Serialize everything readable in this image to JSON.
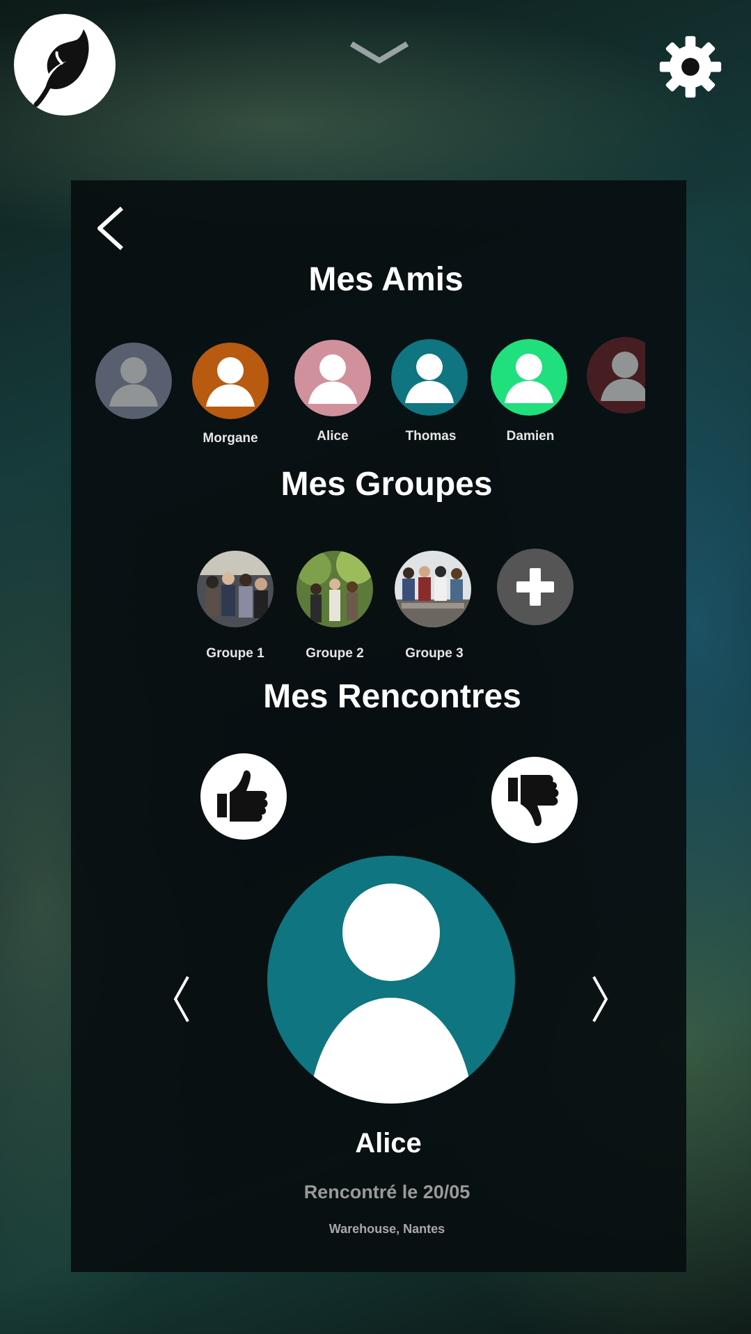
{
  "header": {
    "logo_icon": "leaf-logo-icon",
    "collapse_icon": "chevron-down-icon",
    "settings_icon": "gear-icon"
  },
  "panel": {
    "back_icon": "chevron-left-icon",
    "friends_title": "Mes Amis",
    "friends": [
      {
        "name": "",
        "color": "#9aa0bb"
      },
      {
        "name": "Morgane",
        "color": "#b85a10"
      },
      {
        "name": "Alice",
        "color": "#d0919c"
      },
      {
        "name": "Thomas",
        "color": "#0f7580"
      },
      {
        "name": "Damien",
        "color": "#1fe07d"
      },
      {
        "name": "",
        "color": "#7a2a2f"
      }
    ],
    "groups_title": "Mes Groupes",
    "groups": [
      {
        "name": "Groupe 1"
      },
      {
        "name": "Groupe 2"
      },
      {
        "name": "Groupe 3"
      }
    ],
    "add_group_icon": "plus-icon",
    "encounters_title": "Mes Rencontres",
    "like_icon": "thumbs-up-icon",
    "dislike_icon": "thumbs-down-icon",
    "encounter": {
      "name": "Alice",
      "met_text": "Rencontré le 20/05",
      "place": "Warehouse, Nantes",
      "avatar_color": "#0f7580"
    }
  }
}
